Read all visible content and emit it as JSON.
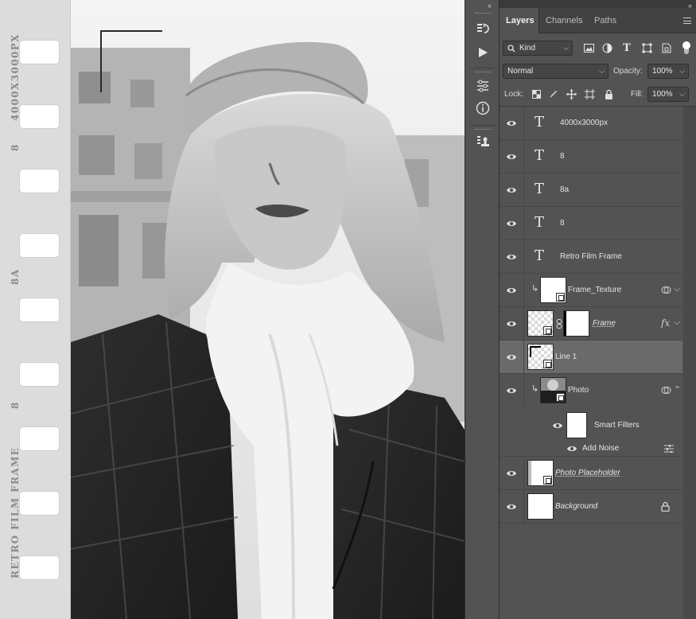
{
  "film_strip": {
    "labels": [
      "4000X3000PX",
      "8",
      "8A",
      "8",
      "RETRO FILM FRAME"
    ]
  },
  "tool_strip": {
    "collapse_left": "‹‹",
    "collapse_right": "››",
    "icons": [
      "history-icon",
      "play-action-icon",
      "adjustments-icon",
      "info-icon",
      "clone-source-icon"
    ]
  },
  "panel": {
    "tabs": [
      {
        "label": "Layers",
        "active": true
      },
      {
        "label": "Channels",
        "active": false
      },
      {
        "label": "Paths",
        "active": false
      }
    ],
    "filter": {
      "kind_label": "Kind"
    },
    "blend_mode": "Normal",
    "opacity_label": "Opacity:",
    "opacity_value": "100%",
    "lock_label": "Lock:",
    "fill_label": "Fill:",
    "fill_value": "100%"
  },
  "layers": [
    {
      "name": "4000x3000px",
      "type": "text"
    },
    {
      "name": "8",
      "type": "text"
    },
    {
      "name": "8a",
      "type": "text"
    },
    {
      "name": "8",
      "type": "text"
    },
    {
      "name": "Retro Film Frame",
      "type": "text"
    },
    {
      "name": "Frame_Texture",
      "type": "smart-object",
      "clipped": true
    },
    {
      "name": "Frame",
      "type": "smart-object-masked",
      "fx": "fx"
    },
    {
      "name": "Line 1",
      "type": "smart-object",
      "selected": true
    },
    {
      "name": "Photo",
      "type": "smart-object",
      "clipped": true
    },
    {
      "name": "Photo Placeholder",
      "type": "smart-object"
    },
    {
      "name": "Background",
      "type": "background"
    }
  ],
  "smart_filters": {
    "label": "Smart Filters",
    "filter_name": "Add Noise"
  }
}
